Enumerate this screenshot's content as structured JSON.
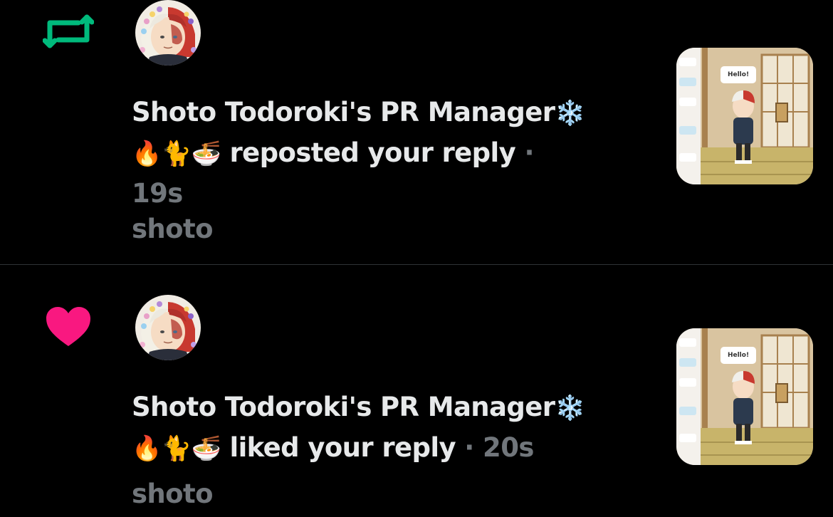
{
  "notifications": [
    {
      "type": "repost",
      "icon": "repost-icon",
      "icon_color": "#00ba7c",
      "display_name": "Shoto Todoroki's PR Manager",
      "name_emoji_1": "❄️",
      "name_emoji_2": "🔥🐈🍜",
      "action": "reposted your reply",
      "separator": "·",
      "time": "19s",
      "post_text": "shoto",
      "thumbnail_caption": "Hello!"
    },
    {
      "type": "like",
      "icon": "heart-icon",
      "icon_color": "#f91880",
      "display_name": "Shoto Todoroki's PR Manager",
      "name_emoji_1": "❄️",
      "name_emoji_2": "🔥🐈🍜",
      "action": "liked your reply",
      "separator": "·",
      "time": "20s",
      "post_text": "shoto",
      "thumbnail_caption": "Hello!"
    }
  ],
  "colors": {
    "background": "#000000",
    "primary_text": "#e7e9ea",
    "secondary_text": "#71767b",
    "divider": "#2f3336"
  }
}
